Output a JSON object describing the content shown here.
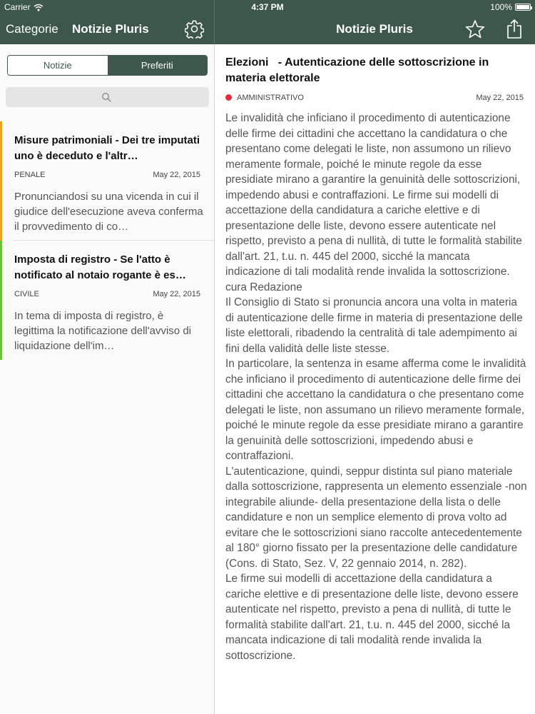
{
  "status_bar": {
    "carrier": "Carrier",
    "time": "4:37 PM",
    "battery": "100%"
  },
  "nav_left": {
    "back_label": "Categorie",
    "title": "Notizie Pluris",
    "settings_icon": "gear-icon"
  },
  "nav_right": {
    "title": "Notizie Pluris",
    "favorite_icon": "star-icon",
    "share_icon": "share-icon"
  },
  "segmented": {
    "tab_news": "Notizie",
    "tab_favorites": "Preferiti",
    "selected": "Preferiti"
  },
  "search": {
    "icon": "search-icon",
    "placeholder": ""
  },
  "colors": {
    "bar": "#3d574c",
    "accent_penale": "#f0a21e",
    "accent_civile": "#6cbf3c",
    "accent_amministrativo": "#e22d3d"
  },
  "list": [
    {
      "title": "Misure patrimoniali - Dei tre imputati uno è deceduto e l'altr…",
      "category": "PENALE",
      "date": "May 22, 2015",
      "excerpt": "Pronunciandosi su una vicenda in cui il giudice dell'esecuzione aveva conferma il provvedimento di co…"
    },
    {
      "title": "Imposta di registro - Se l'atto è notificato al notaio rogante è es…",
      "category": "CIVILE",
      "date": "May 22, 2015",
      "excerpt": "In tema di imposta di registro, è legittima la notificazione dell'avviso di liquidazione dell'im…"
    }
  ],
  "article": {
    "title": "Elezioni   - Autenticazione delle sottoscrizione in materia elettorale",
    "category": "AMMINISTRATIVO",
    "date": "May 22, 2015",
    "body": "Le invalidità che inficiano il procedimento di autenticazione delle firme dei cittadini che accettano la candidatura o che presentano come delegati le liste, non assumono un rilievo meramente formale, poiché le minute regole da esse presidiate mirano a garantire la genuinità delle sottoscrizioni, impedendo abusi e contraffazioni. Le firme sui modelli di accettazione della candidatura a cariche elettive e di presentazione delle liste, devono essere autenticate nel rispetto, previsto a pena di nullità, di tutte le formalità stabilite dall'art. 21, t.u. n. 445 del 2000, sicché la mancata indicazione di tali modalità rende invalida la sottoscrizione.\ncura Redazione\nIl Consiglio di Stato si pronuncia ancora una volta in materia di autenticazione delle firme in materia di presentazione delle liste elettorali, ribadendo la centralità di tale adempimento ai fini della validità delle liste stesse.\nIn particolare, la sentenza in esame afferma come le invalidità che inficiano il procedimento di autenticazione delle firme dei cittadini che accettano la candidatura o che presentano come delegati le liste, non assumano un rilievo meramente formale, poiché le minute regole da esse presidiate mirano a garantire la genuinità delle sottoscrizioni, impedendo abusi e contraffazioni.\nL'autenticazione, quindi, seppur distinta sul piano materiale dalla sottoscrizione, rappresenta un elemento essenziale -non integrabile aliunde- della presentazione della lista o delle candidature e non un semplice elemento di prova volto ad evitare che le sottoscrizioni siano raccolte antecedentemente al 180° giorno fissato per la presentazione delle candidature (Cons. di Stato, Sez. V, 22 gennaio 2014, n. 282).\nLe firme sui modelli di accettazione della candidatura a cariche elettive e di presentazione delle liste, devono essere autenticate nel rispetto, previsto a pena di nullità, di tutte le formalità stabilite dall'art. 21, t.u. n. 445 del 2000, sicché la mancata indicazione di tali modalità rende invalida la sottoscrizione."
  }
}
